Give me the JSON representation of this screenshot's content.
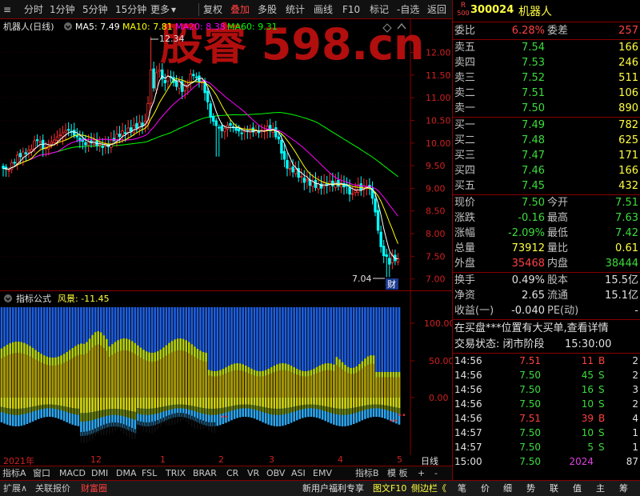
{
  "toolbar": {
    "items": [
      "分时",
      "1分钟",
      "5分钟",
      "15分钟",
      "更多",
      "复权",
      "叠加",
      "多股",
      "统计",
      "画线",
      "F10",
      "标记",
      "-自选",
      "返回"
    ]
  },
  "main_chart": {
    "title": "机器人(日线)",
    "ma": [
      {
        "label": "MA5: 7.49",
        "color": "#ffffff"
      },
      {
        "label": "MA10: 7.81",
        "color": "#ffff00"
      },
      {
        "label": "MA20: 8.38",
        "color": "#ff00ff"
      },
      {
        "label": "MA60: 9.31",
        "color": "#00ff00"
      }
    ],
    "high_label": "12.34",
    "low_label": "7.04",
    "badge": "财",
    "watermark": "股睿 598.cn"
  },
  "indicator": {
    "title": "指标公式",
    "value": "风景: -11.45",
    "y_ticks": [
      "100.00",
      "50.00",
      "0.00"
    ]
  },
  "axis": {
    "labels": [
      "2021年",
      "12",
      "1",
      "2",
      "3",
      "4",
      "5"
    ],
    "period": "日线"
  },
  "tabs": [
    "指标A",
    "窗口",
    "MACD",
    "DMI",
    "DMA",
    "FSL",
    "TRIX",
    "BRAR",
    "CR",
    "VR",
    "OBV",
    "ASI",
    "EMV",
    "指标B",
    "模 板",
    "+",
    "-"
  ],
  "status": {
    "left": [
      "扩展∧",
      "关联报价",
      "财富圈"
    ],
    "middle": [
      "新用户福利专享",
      "图文F10",
      "侧边栏《"
    ],
    "right": [
      "笔",
      "价",
      "细",
      "势",
      "联",
      "值",
      "主",
      "筹"
    ]
  },
  "quote": {
    "market_tag": "R",
    "market_sub": "500",
    "code": "300024",
    "name": "机器人",
    "weibi_label": "委比",
    "weibi": "6.28%",
    "weicha_label": "委差",
    "weicha": "257",
    "asks": [
      {
        "label": "卖五",
        "price": "7.54",
        "vol": "166"
      },
      {
        "label": "卖四",
        "price": "7.53",
        "vol": "246"
      },
      {
        "label": "卖三",
        "price": "7.52",
        "vol": "511"
      },
      {
        "label": "卖二",
        "price": "7.51",
        "vol": "106"
      },
      {
        "label": "卖一",
        "price": "7.50",
        "vol": "890"
      }
    ],
    "bids": [
      {
        "label": "买一",
        "price": "7.49",
        "vol": "782"
      },
      {
        "label": "买二",
        "price": "7.48",
        "vol": "625"
      },
      {
        "label": "买三",
        "price": "7.47",
        "vol": "171"
      },
      {
        "label": "买四",
        "price": "7.46",
        "vol": "166"
      },
      {
        "label": "买五",
        "price": "7.45",
        "vol": "432"
      }
    ],
    "stats": [
      {
        "l1": "现价",
        "v1": "7.50",
        "c1": "green",
        "l2": "今开",
        "v2": "7.51",
        "c2": "green"
      },
      {
        "l1": "涨跌",
        "v1": "-0.16",
        "c1": "green",
        "l2": "最高",
        "v2": "7.63",
        "c2": "green"
      },
      {
        "l1": "涨幅",
        "v1": "-2.09%",
        "c1": "green",
        "l2": "最低",
        "v2": "7.42",
        "c2": "green"
      },
      {
        "l1": "总量",
        "v1": "73912",
        "c1": "yellow",
        "l2": "量比",
        "v2": "0.61",
        "c2": "yellow"
      },
      {
        "l1": "外盘",
        "v1": "35468",
        "c1": "red",
        "l2": "内盘",
        "v2": "38444",
        "c2": "green"
      }
    ],
    "stats2": [
      {
        "l1": "换手",
        "v1": "0.49%",
        "l2": "股本",
        "v2": "15.5亿"
      },
      {
        "l1": "净资",
        "v1": "2.65",
        "l2": "流通",
        "v2": "15.1亿"
      },
      {
        "l1": "收益(一)",
        "v1": "-0.040",
        "l2": "PE(动)",
        "v2": "-"
      }
    ],
    "notice": "在买盘***位置有大买单,查看详情",
    "trade_state": "交易状态: 闭市阶段",
    "trade_time": "15:30:00",
    "ticks": [
      {
        "t": "14:56",
        "p": "7.51",
        "v": "11",
        "bs": "B",
        "n": "2"
      },
      {
        "t": "14:56",
        "p": "7.50",
        "v": "45",
        "bs": "S",
        "n": "2"
      },
      {
        "t": "14:56",
        "p": "7.50",
        "v": "16",
        "bs": "S",
        "n": "3"
      },
      {
        "t": "14:56",
        "p": "7.50",
        "v": "10",
        "bs": "S",
        "n": "2"
      },
      {
        "t": "14:56",
        "p": "7.51",
        "v": "39",
        "bs": "B",
        "n": "4"
      },
      {
        "t": "14:57",
        "p": "7.50",
        "v": "10",
        "bs": "S",
        "n": "1"
      },
      {
        "t": "14:57",
        "p": "7.50",
        "v": "5",
        "bs": "S",
        "n": "1"
      },
      {
        "t": "15:00",
        "p": "7.50",
        "v": "2024",
        "bs": "",
        "n": "87"
      }
    ]
  },
  "chart_data": {
    "type": "candlestick",
    "y_ticks": [
      7.0,
      7.5,
      8.0,
      8.5,
      9.0,
      9.5,
      10.0,
      10.5,
      11.0,
      11.5,
      12.0
    ],
    "ylim": [
      6.8,
      12.45
    ],
    "x_labels": [
      "2021年",
      "12",
      "1",
      "2",
      "3",
      "4",
      "5"
    ],
    "high": 12.34,
    "low": 7.04,
    "ma_last": {
      "MA5": 7.49,
      "MA10": 7.81,
      "MA20": 8.38,
      "MA60": 9.31
    },
    "indicator_value": -11.45
  }
}
